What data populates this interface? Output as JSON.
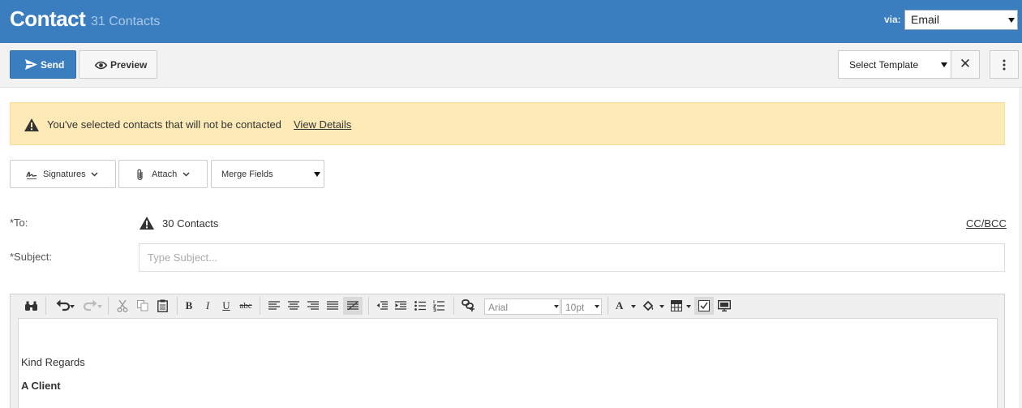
{
  "header": {
    "title": "Contact",
    "count": "31 Contacts",
    "via_label": "via:",
    "via_value": "Email"
  },
  "toolbar": {
    "send_label": "Send",
    "preview_label": "Preview",
    "template_placeholder": "Select Template",
    "clear_symbol": "✕"
  },
  "alert": {
    "message": "You've selected contacts that will not be contacted",
    "link": "View Details"
  },
  "compose": {
    "signatures_label": "Signatures",
    "attach_label": "Attach",
    "merge_fields_label": "Merge Fields",
    "to_label": "*To:",
    "to_value": "30 Contacts",
    "cc_bcc": "CC/BCC",
    "subject_label": "*Subject:",
    "subject_placeholder": "Type Subject...",
    "subject_value": ""
  },
  "editor": {
    "font": "Arial",
    "size": "10pt",
    "body_line1": "Kind Regards",
    "body_line2": "A Client"
  },
  "icons": {
    "send": "paper-plane-icon",
    "preview": "eye-icon",
    "warning": "warning-triangle-icon",
    "signature": "signature-icon",
    "attach": "paperclip-icon",
    "more": "vertical-ellipsis-icon"
  },
  "colors": {
    "header_bg": "#3a7ec0",
    "primary_button": "#3a7ec0",
    "alert_bg": "#fdeab6"
  }
}
